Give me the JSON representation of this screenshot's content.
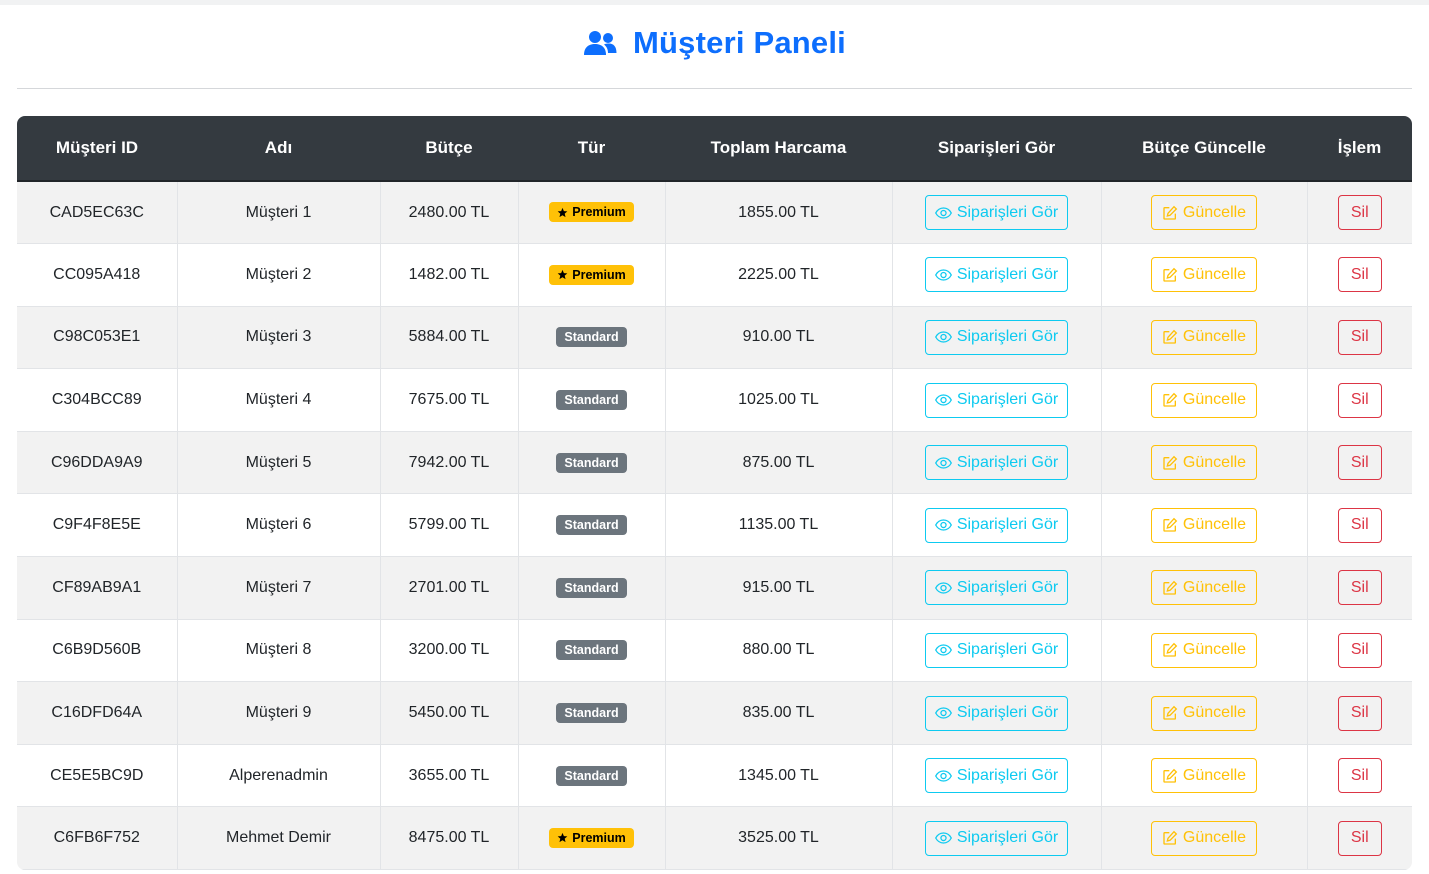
{
  "header": {
    "title": "Müşteri Paneli",
    "icon": "users-icon",
    "accent_color": "#0d6efd"
  },
  "table": {
    "columns": [
      "Müşteri ID",
      "Adı",
      "Bütçe",
      "Tür",
      "Toplam Harcama",
      "Siparişleri Gör",
      "Bütçe Güncelle",
      "İşlem"
    ],
    "view_orders_label": "Siparişleri Gör",
    "update_label": "Güncelle",
    "delete_label": "Sil",
    "rows": [
      {
        "id": "CAD5EC63C",
        "name": "Müşteri 1",
        "budget": "2480.00 TL",
        "type": "Premium",
        "total": "1855.00 TL"
      },
      {
        "id": "CC095A418",
        "name": "Müşteri 2",
        "budget": "1482.00 TL",
        "type": "Premium",
        "total": "2225.00 TL"
      },
      {
        "id": "C98C053E1",
        "name": "Müşteri 3",
        "budget": "5884.00 TL",
        "type": "Standard",
        "total": "910.00 TL"
      },
      {
        "id": "C304BCC89",
        "name": "Müşteri 4",
        "budget": "7675.00 TL",
        "type": "Standard",
        "total": "1025.00 TL"
      },
      {
        "id": "C96DDA9A9",
        "name": "Müşteri 5",
        "budget": "7942.00 TL",
        "type": "Standard",
        "total": "875.00 TL"
      },
      {
        "id": "C9F4F8E5E",
        "name": "Müşteri 6",
        "budget": "5799.00 TL",
        "type": "Standard",
        "total": "1135.00 TL"
      },
      {
        "id": "CF89AB9A1",
        "name": "Müşteri 7",
        "budget": "2701.00 TL",
        "type": "Standard",
        "total": "915.00 TL"
      },
      {
        "id": "C6B9D560B",
        "name": "Müşteri 8",
        "budget": "3200.00 TL",
        "type": "Standard",
        "total": "880.00 TL"
      },
      {
        "id": "C16DFD64A",
        "name": "Müşteri 9",
        "budget": "5450.00 TL",
        "type": "Standard",
        "total": "835.00 TL"
      },
      {
        "id": "CE5E5BC9D",
        "name": "Alperenadmin",
        "budget": "3655.00 TL",
        "type": "Standard",
        "total": "1345.00 TL"
      },
      {
        "id": "C6FB6F752",
        "name": "Mehmet Demir",
        "budget": "8475.00 TL",
        "type": "Premium",
        "total": "3525.00 TL"
      }
    ]
  },
  "colors": {
    "header_bg": "#343a40",
    "premium": "#ffc107",
    "standard": "#6c757d",
    "info": "#0dcaf0",
    "warning": "#ffc107",
    "danger": "#dc3545"
  }
}
